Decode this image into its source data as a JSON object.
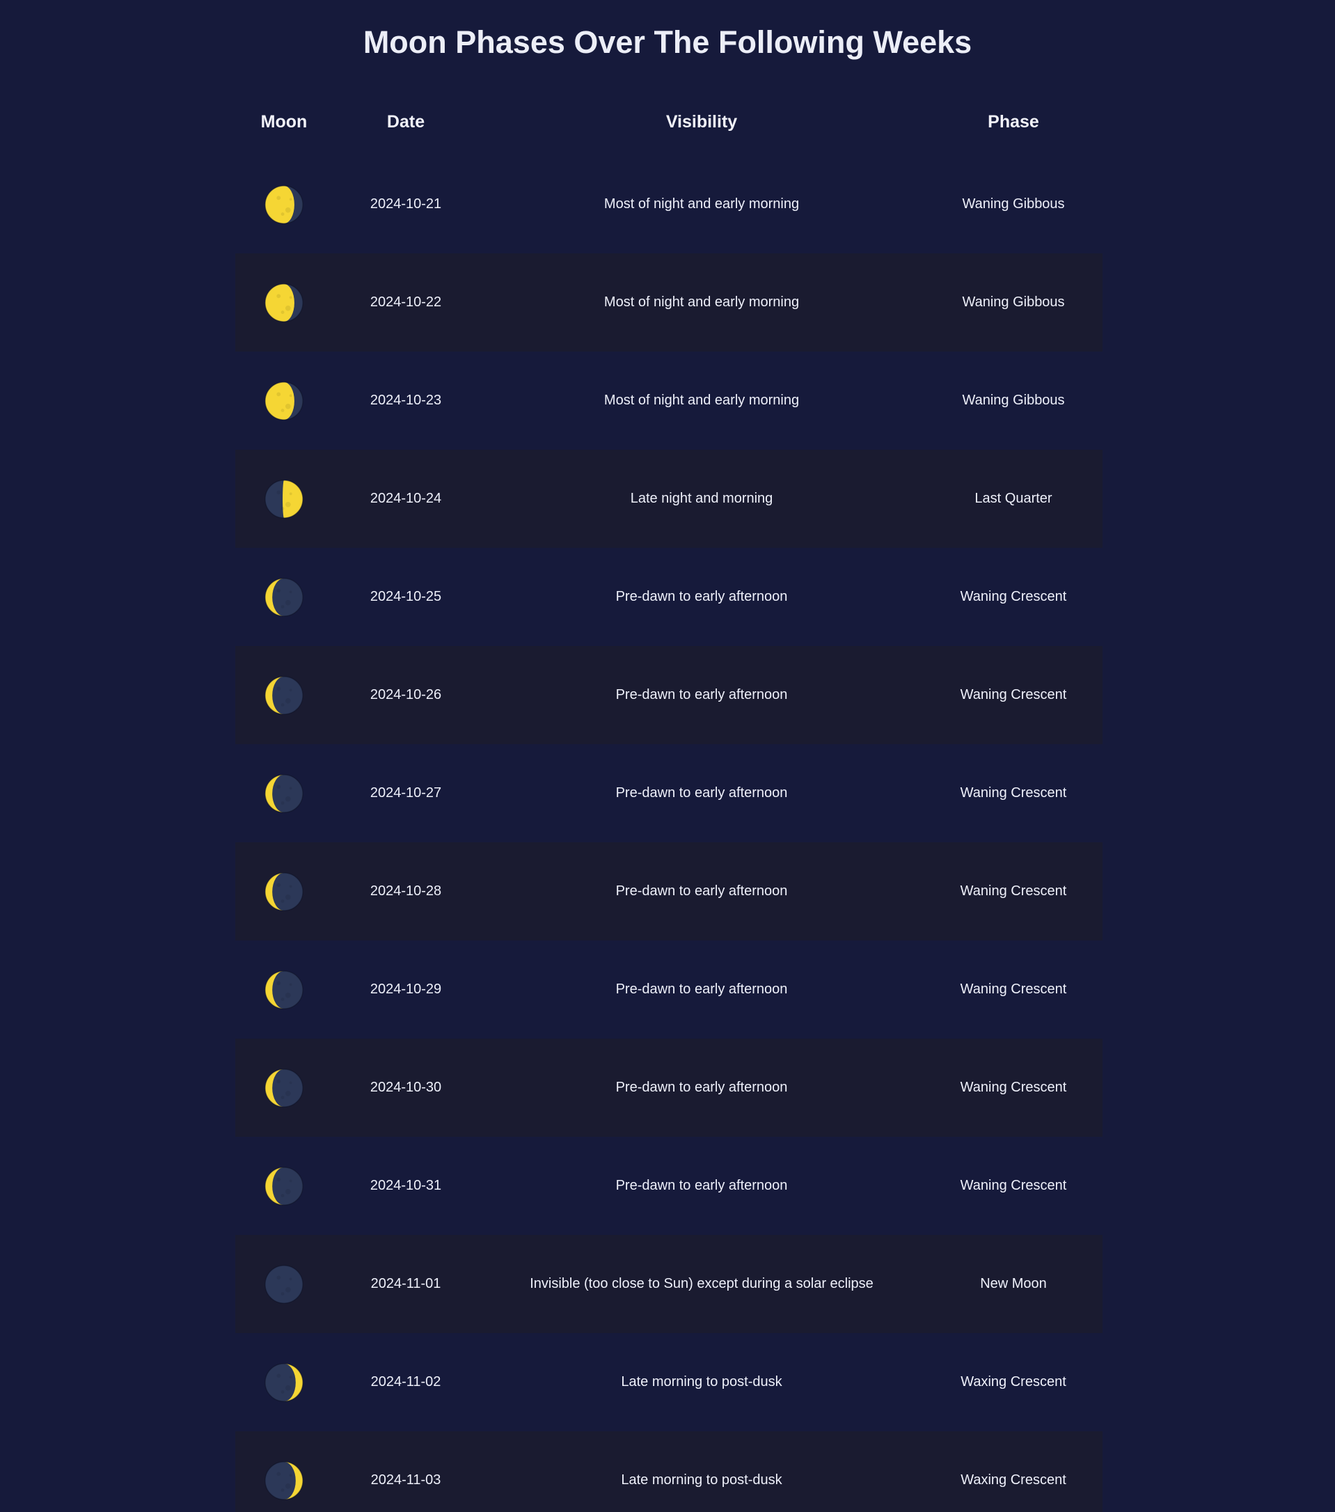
{
  "page": {
    "title": "Moon Phases Over The Following Weeks"
  },
  "table": {
    "headers": [
      "Moon",
      "Date",
      "Visibility",
      "Phase"
    ],
    "rows": [
      {
        "moon_icon": "waning-gibbous-moon-icon",
        "date": "2024-10-21",
        "visibility": "Most of night and early morning",
        "phase": "Waning Gibbous"
      },
      {
        "moon_icon": "waning-gibbous-moon-icon",
        "date": "2024-10-22",
        "visibility": "Most of night and early morning",
        "phase": "Waning Gibbous"
      },
      {
        "moon_icon": "waning-gibbous-moon-icon",
        "date": "2024-10-23",
        "visibility": "Most of night and early morning",
        "phase": "Waning Gibbous"
      },
      {
        "moon_icon": "last-quarter-moon-icon",
        "date": "2024-10-24",
        "visibility": "Late night and morning",
        "phase": "Last Quarter"
      },
      {
        "moon_icon": "waning-crescent-moon-icon",
        "date": "2024-10-25",
        "visibility": "Pre-dawn to early afternoon",
        "phase": "Waning Crescent"
      },
      {
        "moon_icon": "waning-crescent-moon-icon",
        "date": "2024-10-26",
        "visibility": "Pre-dawn to early afternoon",
        "phase": "Waning Crescent"
      },
      {
        "moon_icon": "waning-crescent-moon-icon",
        "date": "2024-10-27",
        "visibility": "Pre-dawn to early afternoon",
        "phase": "Waning Crescent"
      },
      {
        "moon_icon": "waning-crescent-moon-icon",
        "date": "2024-10-28",
        "visibility": "Pre-dawn to early afternoon",
        "phase": "Waning Crescent"
      },
      {
        "moon_icon": "waning-crescent-moon-icon",
        "date": "2024-10-29",
        "visibility": "Pre-dawn to early afternoon",
        "phase": "Waning Crescent"
      },
      {
        "moon_icon": "waning-crescent-moon-icon",
        "date": "2024-10-30",
        "visibility": "Pre-dawn to early afternoon",
        "phase": "Waning Crescent"
      },
      {
        "moon_icon": "waning-crescent-moon-icon",
        "date": "2024-10-31",
        "visibility": "Pre-dawn to early afternoon",
        "phase": "Waning Crescent"
      },
      {
        "moon_icon": "new-moon-icon",
        "date": "2024-11-01",
        "visibility": "Invisible (too close to Sun) except during a solar eclipse",
        "phase": "New Moon"
      },
      {
        "moon_icon": "waxing-crescent-moon-icon",
        "date": "2024-11-02",
        "visibility": "Late morning to post-dusk",
        "phase": "Waxing Crescent"
      },
      {
        "moon_icon": "waxing-crescent-moon-icon",
        "date": "2024-11-03",
        "visibility": "Late morning to post-dusk",
        "phase": "Waxing Crescent"
      }
    ]
  },
  "colors": {
    "background": "#161a3b",
    "row_alt_background": "#1a1b30",
    "moon_lit": "#f5d634",
    "moon_dark": "#2c3858",
    "text": "#eef0fa"
  }
}
